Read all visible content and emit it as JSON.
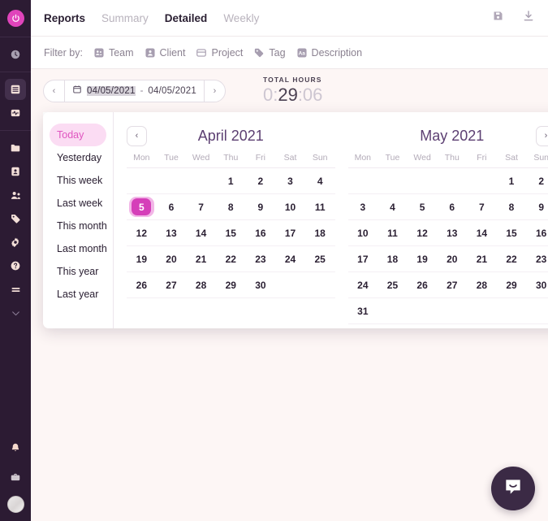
{
  "colors": {
    "rail_bg": "#2c1b33",
    "accent_magenta": "#d53fb9",
    "accent_pink_soft": "#fbdcf3",
    "page_bg": "#fdf6f5",
    "title_purple": "#5c3f72",
    "chat_bg": "#3b2a45"
  },
  "rail": {
    "logo": "power-timer-logo",
    "groups": [
      {
        "items": [
          {
            "icon": "clock-icon",
            "name": "timer",
            "active": false
          }
        ]
      },
      {
        "items": [
          {
            "icon": "reports-icon",
            "name": "reports",
            "active": true
          },
          {
            "icon": "activity-icon",
            "name": "activity",
            "active": false
          }
        ]
      },
      {
        "items": [
          {
            "icon": "folder-icon",
            "name": "projects",
            "active": false
          },
          {
            "icon": "client-icon",
            "name": "clients",
            "active": false
          },
          {
            "icon": "team-icon",
            "name": "team",
            "active": false
          },
          {
            "icon": "tag-icon",
            "name": "tags",
            "active": false
          },
          {
            "icon": "gear-icon",
            "name": "settings",
            "active": false
          },
          {
            "icon": "help-icon",
            "name": "help",
            "active": false
          },
          {
            "icon": "menu-icon",
            "name": "more",
            "active": false
          },
          {
            "icon": "chevron-down-icon",
            "name": "collapse",
            "active": false
          }
        ]
      }
    ],
    "bottom": [
      {
        "icon": "bell-icon",
        "name": "notifications"
      },
      {
        "icon": "briefcase-icon",
        "name": "workspace"
      },
      {
        "icon": "avatar",
        "name": "user-avatar"
      }
    ]
  },
  "header": {
    "title": "Reports",
    "tabs": [
      {
        "label": "Summary",
        "active": false
      },
      {
        "label": "Detailed",
        "active": true
      },
      {
        "label": "Weekly",
        "active": false
      }
    ],
    "actions": [
      {
        "icon": "save-icon",
        "name": "save-report"
      },
      {
        "icon": "download-icon",
        "name": "export-report"
      }
    ]
  },
  "filter": {
    "label": "Filter by:",
    "chips": [
      {
        "label": "Team",
        "icon": "team-icon"
      },
      {
        "label": "Client",
        "icon": "client-icon"
      },
      {
        "label": "Project",
        "icon": "folder-icon"
      },
      {
        "label": "Tag",
        "icon": "tag-icon"
      },
      {
        "label": "Description",
        "icon": "text-icon"
      }
    ]
  },
  "toolbar": {
    "prev_label": "‹",
    "next_label": "›",
    "calendar_icon": "calendar-icon",
    "date_start": "04/05/2021",
    "date_separator": "-",
    "date_end": "04/05/2021",
    "totals_label": "TOTAL HOURS",
    "total_hours_prefix": "0:",
    "total_hours_main": "29",
    "total_hours_suffix": ":06"
  },
  "picker": {
    "presets": [
      {
        "label": "Today",
        "active": true
      },
      {
        "label": "Yesterday",
        "active": false
      },
      {
        "label": "This week",
        "active": false
      },
      {
        "label": "Last week",
        "active": false
      },
      {
        "label": "This month",
        "active": false
      },
      {
        "label": "Last month",
        "active": false
      },
      {
        "label": "This year",
        "active": false
      },
      {
        "label": "Last year",
        "active": false
      }
    ],
    "weekdays": [
      "Mon",
      "Tue",
      "Wed",
      "Thu",
      "Fri",
      "Sat",
      "Sun"
    ],
    "prev_label": "‹",
    "next_label": "›",
    "months": [
      {
        "title": "April 2021",
        "weeks": [
          [
            "",
            "",
            "",
            "1",
            "2",
            "3",
            "4"
          ],
          [
            "5",
            "6",
            "7",
            "8",
            "9",
            "10",
            "11"
          ],
          [
            "12",
            "13",
            "14",
            "15",
            "16",
            "17",
            "18"
          ],
          [
            "19",
            "20",
            "21",
            "22",
            "23",
            "24",
            "25"
          ],
          [
            "26",
            "27",
            "28",
            "29",
            "30",
            "",
            ""
          ]
        ],
        "selected": "5"
      },
      {
        "title": "May 2021",
        "weeks": [
          [
            "",
            "",
            "",
            "",
            "",
            "1",
            "2"
          ],
          [
            "3",
            "4",
            "5",
            "6",
            "7",
            "8",
            "9"
          ],
          [
            "10",
            "11",
            "12",
            "13",
            "14",
            "15",
            "16"
          ],
          [
            "17",
            "18",
            "19",
            "20",
            "21",
            "22",
            "23"
          ],
          [
            "24",
            "25",
            "26",
            "27",
            "28",
            "29",
            "30"
          ],
          [
            "31",
            "",
            "",
            "",
            "",
            "",
            ""
          ]
        ],
        "selected": null
      }
    ]
  },
  "chat": {
    "icon": "chat-smile-icon",
    "name": "support-chat"
  }
}
